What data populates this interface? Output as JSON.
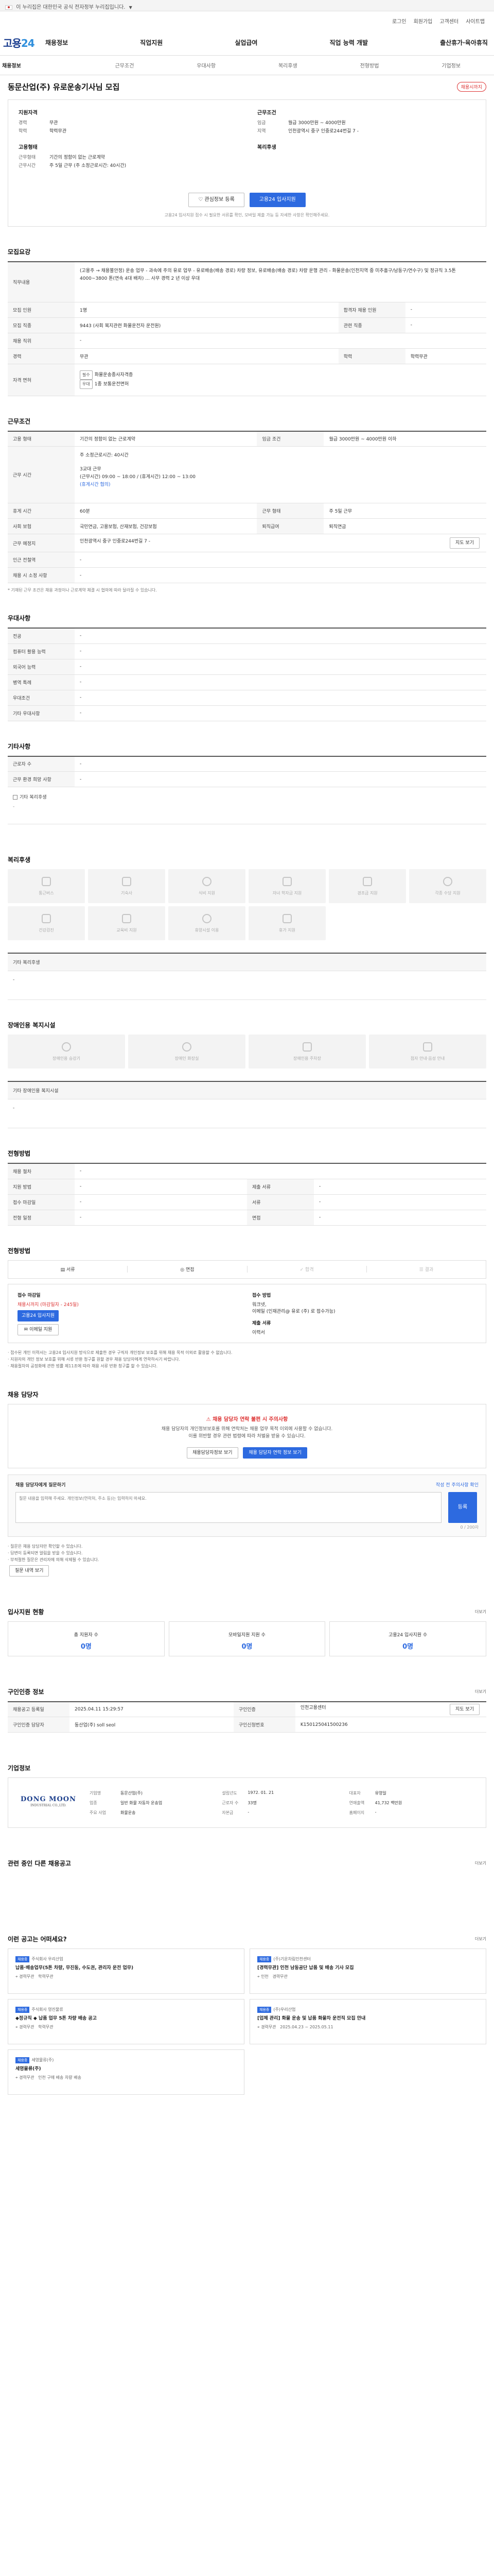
{
  "gov_banner": {
    "text": "이 누리집은 대한민국 공식 전자정부 누리집입니다."
  },
  "util": {
    "links": [
      "로그인",
      "회원가입",
      "고객센터",
      "사이트맵"
    ]
  },
  "header": {
    "logo_main": "고용",
    "logo_accent": "24"
  },
  "gnb": [
    "채용정보",
    "직업지원",
    "실업급여",
    "직업 능력 개발",
    "출산휴가·육아휴직"
  ],
  "subnav": [
    "채용정보",
    "근무조건",
    "우대사항",
    "복리후생",
    "전형방법",
    "기업정보"
  ],
  "job": {
    "title": "동문산업(주) 유로운송기사님 모집",
    "status": "채용시까지",
    "summary": {
      "company_group": {
        "label": "지원자격",
        "rows": [
          {
            "k": "경력",
            "v": "무관"
          },
          {
            "k": "학력",
            "v": "학력무관"
          }
        ]
      },
      "condition_group": {
        "label": "근무조건",
        "rows": [
          {
            "k": "임금",
            "v": "월급 3000만원 ~ 4000만원"
          },
          {
            "k": "지역",
            "v": "인천광역시 중구 인중로244번길 7 -"
          }
        ]
      },
      "employ_group": {
        "label": "고용형태",
        "rows": [
          {
            "k": "근무형태",
            "v": "기간의 정함이 없는 근로계약"
          },
          {
            "k": "근무시간",
            "v": "주 5일 근무 (주 소정근로시간: 40시간)"
          }
        ]
      },
      "welfare_group": {
        "label": "복리후생",
        "rows": [
          {
            "k": "",
            "v": ""
          }
        ]
      }
    },
    "buttons": {
      "interest": "관심정보 등록",
      "apply": "고용24 입사지원"
    },
    "notice": "고용24 입사지원 접수 시 필요한 서류를 확인, 모바일 제출 가능 등 자세한 사항은 확인해주세요."
  },
  "recruit": {
    "heading": "모집요강",
    "job_content_label": "직무내용",
    "job_content": "(고용주 → 채용불안정) 운송 업무 - 과속에 주의 유로 업무 - 유로배송(배송 경로) 차량 정보, 유로배송(배송 경로) 차량 운행 관리 - 화물운송(인천지역 중 미추홀구/남동구/연수구) 및 정규직 3.5톤 4000~3800 톤(연속 4대 배차) ... 사무 경력 2 년 이상 우대",
    "rows": [
      {
        "k": "모집 인원",
        "v": "1명",
        "k2": "합격자 채용 인원",
        "v2": "-"
      },
      {
        "k": "모집 직종",
        "v": "9443 (사회 복지관련 화물운전자 운전원)",
        "k2": "관련 직종",
        "v2": "-"
      },
      {
        "k": "채용 직위",
        "v": "-",
        "k2": "",
        "v2": ""
      },
      {
        "k": "경력",
        "v": "무관",
        "k2": "학력",
        "v2": "학력무관"
      }
    ],
    "license_k": "자격 면허",
    "license_tag": "필수",
    "license_v": "화물운송종사자격증",
    "license_tag2": "우대",
    "license_v2": "1종 보통운전면허"
  },
  "conditions": {
    "heading": "근무조건",
    "rows": [
      {
        "k": "고용 형태",
        "v": "기간의 정함이 없는 근로계약",
        "k2": "임금 조건",
        "v2": "월급 3000만원 ~ 4000만원 이하"
      }
    ],
    "work_time_label": "근무 시간",
    "work_time_line1": "주 소정근로시간: 40시간",
    "work_time_line2": "3교대 근무",
    "work_time_line3": "(근무시간) 09:00 ~ 18:00 / (휴게시간) 12:00 ~ 13:00",
    "work_time_tag": "(휴게시간 협의)",
    "rows2": [
      {
        "k": "휴게 시간",
        "v": "60분",
        "k2": "근무 형태",
        "v2": "주 5일 근무"
      },
      {
        "k": "사회 보험",
        "v": "국민연금, 고용보험, 산재보험, 건강보험",
        "k2": "퇴직급여",
        "v2": "퇴직연금"
      }
    ],
    "location_k": "근무 예정지",
    "location_v": "인천광역시 중구 인중로244번길 7 -",
    "map_btn": "지도 보기",
    "nearby_k": "인근 전철역",
    "nearby_v": "-",
    "remark_k": "채용 시 소정 사항",
    "remark_v": "-",
    "note": "* 기재된 근무 조건은 채용 과정이나 근로계약 체결 시 협의에 따라 달라질 수 있습니다."
  },
  "preferred": {
    "heading": "우대사항",
    "rows": [
      {
        "k": "전공",
        "v": "-"
      },
      {
        "k": "컴퓨터 활용 능력",
        "v": "-"
      },
      {
        "k": "외국어 능력",
        "v": "-"
      },
      {
        "k": "병역 특례",
        "v": "-"
      },
      {
        "k": "우대조건",
        "v": "-"
      },
      {
        "k": "기타 우대사항",
        "v": "-"
      }
    ]
  },
  "other": {
    "heading": "기타사항",
    "rows": [
      {
        "k": "근로자 수",
        "v": "-"
      },
      {
        "k": "근무 환경 희망 사항",
        "v": "-"
      }
    ],
    "check_label": "기타 복리후생",
    "check_value": "-"
  },
  "welfare": {
    "heading": "복리후생",
    "tiles": [
      "통근버스",
      "기숙사",
      "식비 지원",
      "자녀 학자금 지원",
      "경조금 지원",
      "각종 수당 지원",
      "건강검진",
      "교육비 지원",
      "휴양시설 이용",
      "휴가 지원",
      "",
      ""
    ],
    "other_label": "기타 복리후생",
    "other_value": "-"
  },
  "disabled": {
    "heading": "장애인용 복지시설",
    "tiles": [
      "장애인용 승강기",
      "장애인 화장실",
      "장애인용 주차장",
      "점자 안내·음성 안내"
    ],
    "other_label": "기타 장애인용 복지시설",
    "other_value": "-"
  },
  "screening": {
    "heading": "전형방법",
    "rows": [
      {
        "k": "채용 절차",
        "v": "-",
        "k2": "",
        "v2": ""
      },
      {
        "k": "지원 방법",
        "v": "-",
        "k2": "제출 서류",
        "v2": "-"
      },
      {
        "k": "접수 마감일",
        "v": "-",
        "k2": "서류",
        "v2": "-"
      },
      {
        "k": "전형 일정",
        "v": "-",
        "k2": "면접",
        "v2": "-"
      }
    ]
  },
  "process": {
    "heading": "전형방법",
    "steps": [
      "서류",
      "면접",
      "합격",
      "결과"
    ],
    "apply_head": "접수 마감일",
    "apply_deadline": "채용시까지 (마감일자 - 245일)",
    "apply_btn": "고용24 입사지원",
    "email_btn": "이메일 지원",
    "method_head": "접수 방법",
    "method_v1": "워크넷,",
    "method_v2": "이메일 (인재관리@ 유로 (주) 로 접수가능)",
    "docs_head": "제출 서류",
    "docs_v": "이력서",
    "bullets": [
      "· 접수된 개인 이력서는 고용24 입사지원 방식으로 제출한 경우 구직자 개인정보 보호를 위해 채용 목적 이외로 활용할 수 없습니다.",
      "· 지원자의 개인 정보 보호를 위해 서류 반환 청구를 원할 경우 채용 담당자에게 연락하시기 바랍니다.",
      "· 채용절차의 공정화에 관한 법률 제11조에 따라 채용 서류 반환 청구를 할 수 있습니다."
    ]
  },
  "contact": {
    "heading": "채용 담당자",
    "warn": "채용 담당자 연락 불편 시 주의사항",
    "line1": "채용 담당자의 개인정보보호를 위해 연락처는 채용 업무 목적 이외에 사용할 수 없습니다.",
    "line2": "이를 위반할 경우 관련 법령에 따라 처벌을 받을 수 있습니다.",
    "btn1": "채용담당자정보 보기",
    "btn2": "채용 담당자 연락 정보 보기"
  },
  "inquiry": {
    "title": "채용 담당자에게 질문하기",
    "counter": "0 / 200자",
    "guide_link": "작성 전 주의사항 확인",
    "placeholder": "질문 내용을 입력해 주세요. 개인정보(연락처, 주소 등)는 입력하지 마세요.",
    "btn": "등록",
    "bullets": [
      "· 질문은 채용 담당자만 확인할 수 있습니다.",
      "· 답변이 등록되면 알림을 받을 수 있습니다.",
      "· 부적절한 질문은 관리자에 의해 삭제될 수 있습니다."
    ],
    "more_btn": "질문 내역 보기"
  },
  "applicants": {
    "heading": "입사지원 현황",
    "more": "더보기",
    "cards": [
      {
        "label": "총 지원자 수",
        "value": "0명"
      },
      {
        "label": "모바일지원 지원 수",
        "value": "0명"
      },
      {
        "label": "고용24 입사지원 수",
        "value": "0명"
      }
    ]
  },
  "recruit_info": {
    "heading": "구인인증 정보",
    "more": "더보기",
    "rows": [
      {
        "k": "채용공고 등록일",
        "v": "2025.04.11 15:29:57",
        "k2": "구인인증",
        "v2": "인천고용센터"
      },
      {
        "k": "구인인증 담당자",
        "v": "동산업(주) soll seol",
        "k2": "구인신청번호",
        "v2": "K150125041500236"
      }
    ],
    "map_btn": "지도 보기"
  },
  "company": {
    "heading": "기업정보",
    "logo_text": "DONG MOON",
    "logo_sub": "INDUSTRIAL CO.,LTD.",
    "info": [
      {
        "k": "기업명",
        "v": "동문산업(주)"
      },
      {
        "k": "업종",
        "v": "일반 화물 자동차 운송업"
      },
      {
        "k": "설립년도",
        "v": "1972. 01. 21"
      },
      {
        "k": "대표자",
        "v": "유영일"
      },
      {
        "k": "주요 사업",
        "v": "화물운송"
      },
      {
        "k": "근로자 수",
        "v": "33명"
      },
      {
        "k": "자본금",
        "v": "-"
      },
      {
        "k": "연매출액",
        "v": "41,732 백만원"
      },
      {
        "k": "홈페이지",
        "v": "-"
      }
    ]
  },
  "related": {
    "heading": "관련 중인 다른 채용공고",
    "more": "더보기"
  },
  "reco": {
    "heading": "이런 공고는 어떠세요?",
    "more": "더보기",
    "cards": [
      {
        "badge": "채용중",
        "company": "주식회사 우리산업",
        "title": "납품·배송업무(5톤 차량, 무진동, 수도권, 관리자 운전 업무)",
        "meta1": "경력무관",
        "meta2": "학력무관"
      },
      {
        "badge": "채용중",
        "company": "(주)기운차림인천센터",
        "title": "[경력무관] 인천 남동공단 납품 및 배송 기사 모집",
        "meta1": "인천",
        "meta2": "경력무관"
      },
      {
        "badge": "채용중",
        "company": "주식회사 영진물류",
        "title": "◆정규직 ◆ 납품 업무 5톤 차량 배송 공고",
        "meta1": "경력무관",
        "meta2": "학력무관"
      },
      {
        "badge": "채용중",
        "company": "(주)우리산업",
        "title": "[업체 관리] 화물 운송 및 납품 화물차 운전직 모집 안내",
        "meta1": "경력무관",
        "meta2": "2025.04.23 ~ 2025.05.11"
      },
      {
        "badge": "채용중",
        "company": "세영물류(주)",
        "title": "세영물류(주)",
        "meta1": "경력무관",
        "meta2": "인천 구매 배송 차량 배송"
      }
    ]
  }
}
